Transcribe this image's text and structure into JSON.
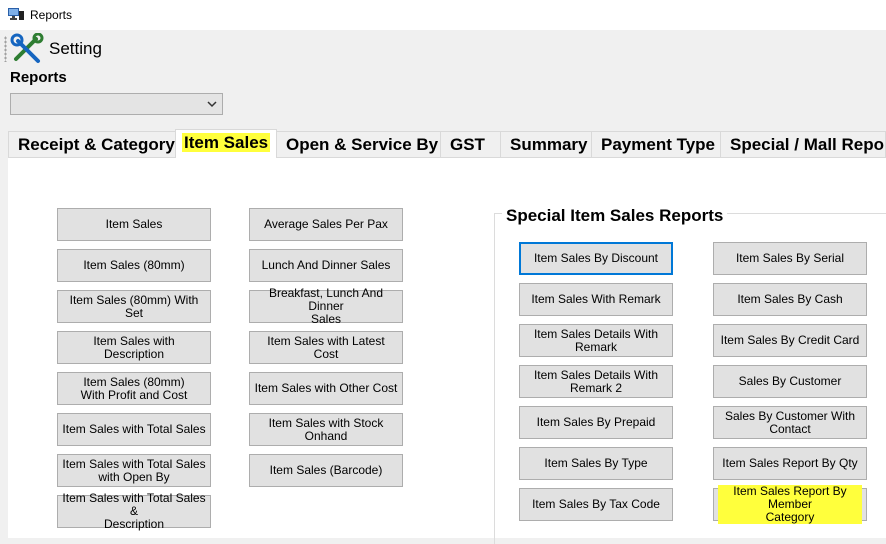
{
  "window": {
    "title": "Reports"
  },
  "toolbar": {
    "setting_label": "Setting"
  },
  "reports_label": "Reports",
  "reports_select": {
    "value": ""
  },
  "tabs": [
    {
      "label": "Receipt & Category"
    },
    {
      "label": "Item Sales"
    },
    {
      "label": "Open & Service By"
    },
    {
      "label": "GST"
    },
    {
      "label": "Summary"
    },
    {
      "label": "Payment Type"
    },
    {
      "label": "Special / Mall Report"
    }
  ],
  "col1": [
    "Item Sales",
    "Item Sales (80mm)",
    "Item Sales (80mm) With Set",
    "Item Sales with Description",
    "Item Sales (80mm)\nWith Profit and Cost",
    "Item Sales with Total Sales",
    "Item Sales with Total Sales\nwith Open By",
    "Item Sales with Total Sales &\nDescription"
  ],
  "col2": [
    "Average Sales Per Pax",
    "Lunch And Dinner Sales",
    "Breakfast, Lunch And Dinner\nSales",
    "Item Sales with Latest Cost",
    "Item Sales with Other Cost",
    "Item Sales with Stock\nOnhand",
    "Item Sales (Barcode)"
  ],
  "special_group": {
    "title": "Special Item Sales Reports",
    "col3": [
      "Item Sales By Discount",
      "Item Sales With Remark",
      "Item Sales Details With\nRemark",
      "Item Sales Details With\nRemark 2",
      "Item Sales By Prepaid",
      "Item Sales By Type",
      "Item Sales By Tax Code"
    ],
    "col4": [
      "Item Sales By Serial",
      "Item Sales By Cash",
      "Item Sales By Credit Card",
      "Sales By Customer",
      "Sales By Customer With\nContact",
      "Item Sales Report By Qty",
      "Item Sales Report By Member\nCategory"
    ]
  },
  "highlight_color": "#ffff3c",
  "focus_color": "#0078d7"
}
